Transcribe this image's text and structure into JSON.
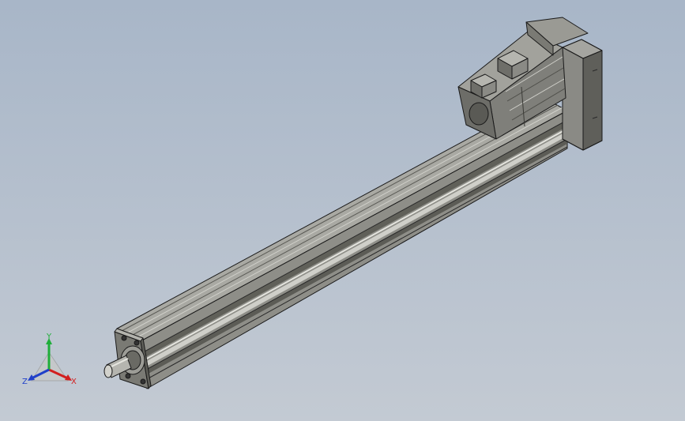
{
  "viewport": {
    "background_top": "#a8b6c8",
    "background_bottom": "#c3cad3"
  },
  "model": {
    "body_color": "#8c8c86",
    "body_dark": "#585853",
    "body_light": "#b8b8b2",
    "edge_color": "#1a1a1a",
    "motor_color": "#7f7f7a"
  },
  "triad": {
    "x_label": "X",
    "y_label": "Y",
    "z_label": "Z",
    "x_color": "#d21f1f",
    "y_color": "#1fae3a",
    "z_color": "#2140c9"
  }
}
